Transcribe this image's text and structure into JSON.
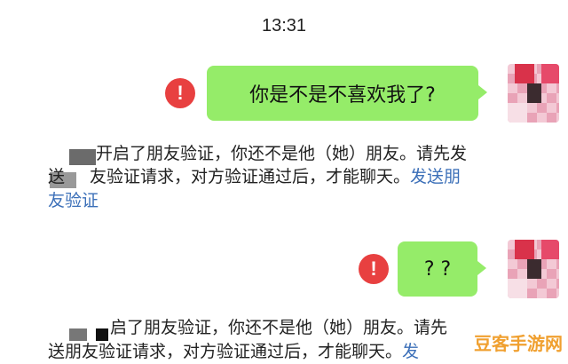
{
  "time": "13:31",
  "messages": [
    {
      "text": "你是不是不喜欢我了?",
      "status_icon": "!"
    },
    {
      "text": "? ?",
      "status_icon": "!"
    }
  ],
  "system_notices": [
    {
      "line1": "开启了朋友验证，你还不是他（她）朋友。请先发",
      "line2": "友验证请求，对方验证通过后，才能聊天。",
      "line2_prefix": "送",
      "link_line2": "发送朋",
      "line3": "友验证"
    },
    {
      "line1": "启了朋友验证，你还不是他（她）朋友。请先",
      "line2": "验证请求，对方验证通过后，才能聊天。",
      "line2_prefix": "送朋友",
      "link_line2": "发"
    }
  ],
  "watermark": "豆客手游网"
}
